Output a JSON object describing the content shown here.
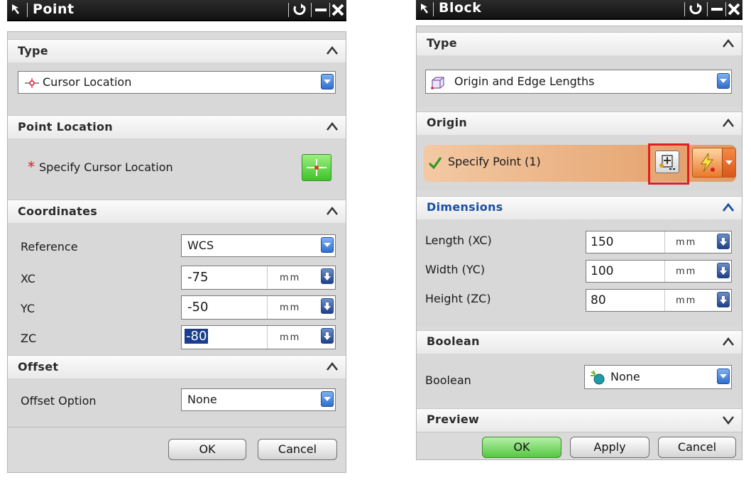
{
  "point_dialog": {
    "title": "Point",
    "sections": {
      "type": {
        "header": "Type",
        "value": "Cursor Location"
      },
      "point_location": {
        "header": "Point Location",
        "required_mark": "*",
        "label": "Specify Cursor Location"
      },
      "coordinates": {
        "header": "Coordinates",
        "reference_label": "Reference",
        "reference_value": "WCS",
        "rows": [
          {
            "label": "XC",
            "value": "-75",
            "unit": "mm"
          },
          {
            "label": "YC",
            "value": "-50",
            "unit": "mm"
          },
          {
            "label": "ZC",
            "value": "-80",
            "unit": "mm"
          }
        ]
      },
      "offset": {
        "header": "Offset",
        "option_label": "Offset Option",
        "option_value": "None"
      }
    },
    "buttons": {
      "ok": "OK",
      "cancel": "Cancel"
    }
  },
  "block_dialog": {
    "title": "Block",
    "sections": {
      "type": {
        "header": "Type",
        "value": "Origin and Edge Lengths"
      },
      "origin": {
        "header": "Origin",
        "specify_point": "Specify Point (1)"
      },
      "dimensions": {
        "header": "Dimensions",
        "rows": [
          {
            "label": "Length (XC)",
            "value": "150",
            "unit": "mm"
          },
          {
            "label": "Width (YC)",
            "value": "100",
            "unit": "mm"
          },
          {
            "label": "Height (ZC)",
            "value": "80",
            "unit": "mm"
          }
        ]
      },
      "boolean": {
        "header": "Boolean",
        "label": "Boolean",
        "value": "None"
      },
      "preview": {
        "header": "Preview"
      }
    },
    "buttons": {
      "ok": "OK",
      "apply": "Apply",
      "cancel": "Cancel"
    }
  },
  "colors": {
    "titlebar": "#1a1a1a",
    "dropdown_accent": "#2f6fce",
    "origin_highlight": "#e9a46e",
    "ok_green": "#55c742",
    "highlight_box": "#e02020"
  }
}
